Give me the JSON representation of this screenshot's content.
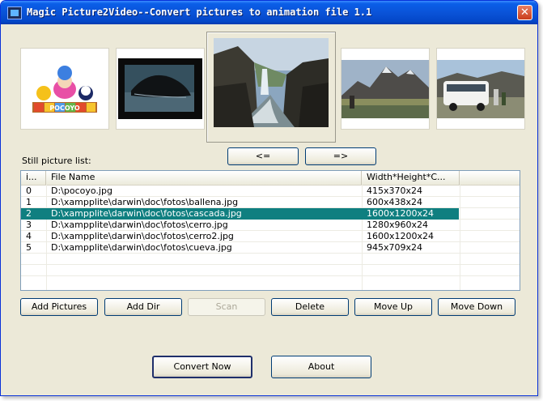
{
  "window": {
    "title": "Magic Picture2Video--Convert pictures to animation file 1.1"
  },
  "thumbnails": [
    {
      "name": "pocoyo",
      "caption": "POCOYO"
    },
    {
      "name": "ballena"
    },
    {
      "name": "cascada",
      "selected": true
    },
    {
      "name": "cerro"
    },
    {
      "name": "cerro2"
    }
  ],
  "nav": {
    "prev_label": "<=",
    "next_label": "=>"
  },
  "list": {
    "label": "Still picture list:",
    "columns": [
      "i...",
      "File Name",
      "Width*Height*C...",
      ""
    ],
    "rows": [
      {
        "index": "0",
        "file": "D:\\pocoyo.jpg",
        "dims": "415x370x24"
      },
      {
        "index": "1",
        "file": "D:\\xampplite\\darwin\\doc\\fotos\\ballena.jpg",
        "dims": "600x438x24"
      },
      {
        "index": "2",
        "file": "D:\\xampplite\\darwin\\doc\\fotos\\cascada.jpg",
        "dims": "1600x1200x24"
      },
      {
        "index": "3",
        "file": "D:\\xampplite\\darwin\\doc\\fotos\\cerro.jpg",
        "dims": "1280x960x24"
      },
      {
        "index": "4",
        "file": "D:\\xampplite\\darwin\\doc\\fotos\\cerro2.jpg",
        "dims": "1600x1200x24"
      },
      {
        "index": "5",
        "file": "D:\\xampplite\\darwin\\doc\\fotos\\cueva.jpg",
        "dims": "945x709x24"
      }
    ],
    "selected_index": 2
  },
  "actions": {
    "add_pictures": "Add Pictures",
    "add_dir": "Add Dir",
    "scan": "Scan",
    "delete": "Delete",
    "move_up": "Move Up",
    "move_down": "Move Down"
  },
  "footer": {
    "convert": "Convert Now",
    "about": "About"
  },
  "colors": {
    "selection": "#0f7f80",
    "titlebar": "#0a53d8"
  }
}
